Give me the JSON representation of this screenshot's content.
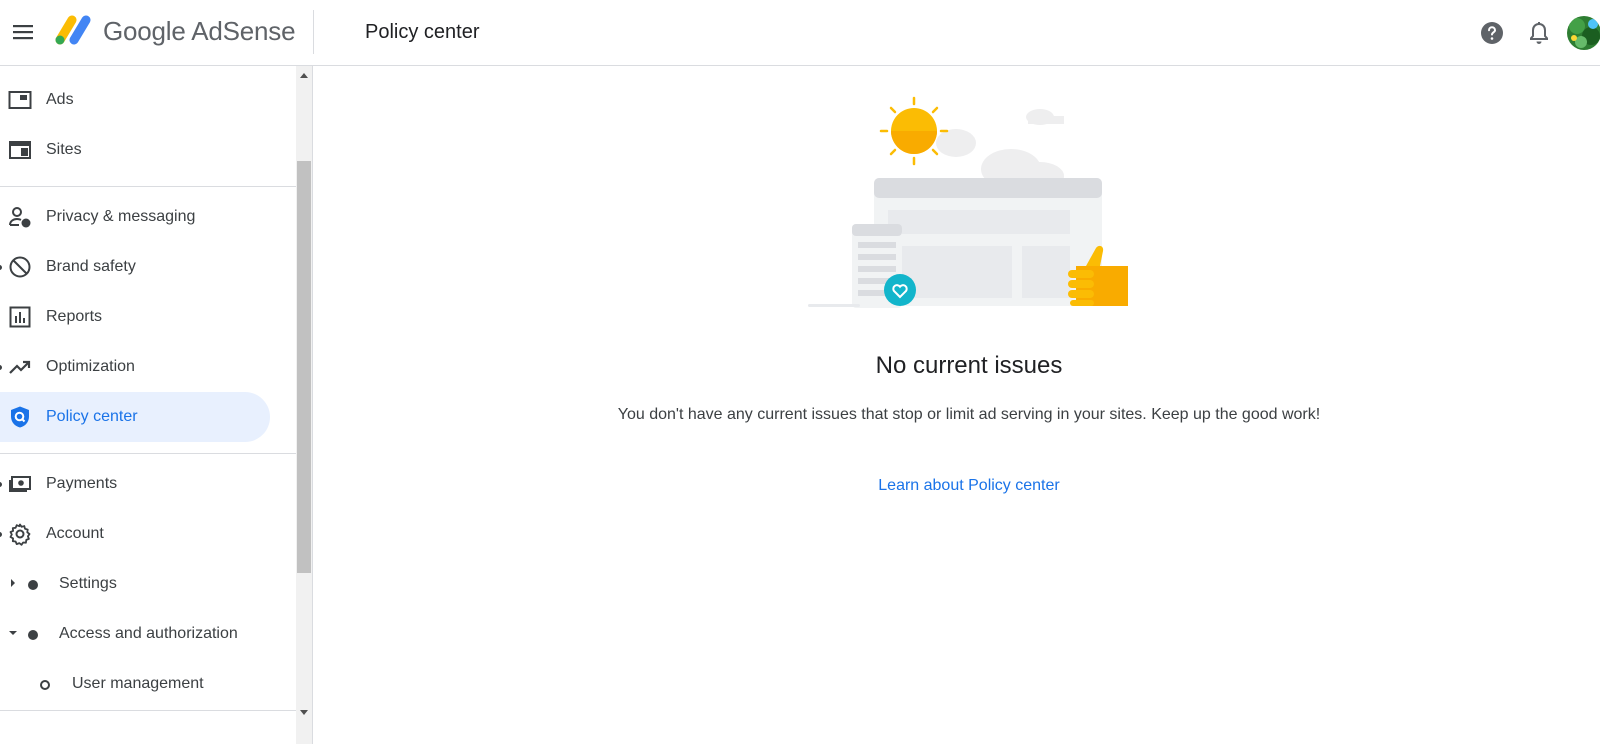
{
  "app": {
    "brand": "Google AdSense",
    "page_title": "Policy center"
  },
  "header": {
    "icons": [
      "menu-icon",
      "help-icon",
      "notifications-icon",
      "avatar"
    ]
  },
  "sidebar": {
    "items": [
      {
        "label": "Ads",
        "icon": "ads-icon"
      },
      {
        "label": "Sites",
        "icon": "sites-icon"
      },
      {
        "label": "Privacy & messaging",
        "icon": "privacy-icon"
      },
      {
        "label": "Brand safety",
        "icon": "block-icon"
      },
      {
        "label": "Reports",
        "icon": "reports-icon"
      },
      {
        "label": "Optimization",
        "icon": "trending-icon"
      },
      {
        "label": "Policy center",
        "icon": "policy-shield-icon",
        "active": true
      },
      {
        "label": "Payments",
        "icon": "payments-icon"
      },
      {
        "label": "Account",
        "icon": "gear-icon"
      },
      {
        "label": "Settings",
        "icon": "bullet"
      },
      {
        "label": "Access and authorization",
        "icon": "bullet"
      },
      {
        "label": "User management",
        "icon": "bullet-outline"
      }
    ]
  },
  "main": {
    "title": "No current issues",
    "description": "You don't have any current issues that stop or limit ad serving in your sites. Keep up the good work!",
    "link": "Learn about Policy center"
  },
  "colors": {
    "accent": "#1a73e8",
    "active_bg": "#e8f0fe",
    "divider": "#dadce0",
    "sun": "#fbbc04",
    "teal": "#12b5cb"
  }
}
